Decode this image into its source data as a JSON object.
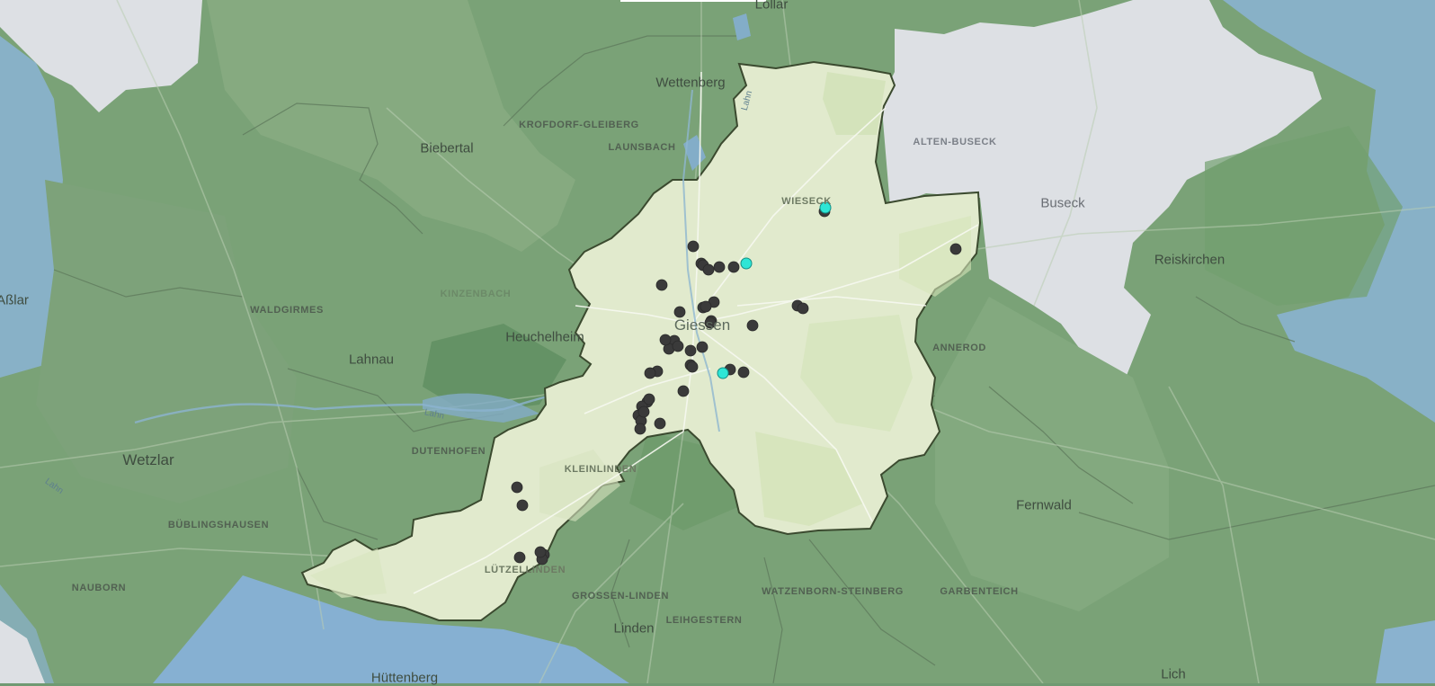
{
  "map": {
    "city_label": "Giessen",
    "town_labels": [
      "Lollar",
      "Wettenberg",
      "Biebertal",
      "Heuchelheim",
      "Lahnau",
      "Wetzlar",
      "Buseck",
      "Reiskirchen",
      "Fernwald",
      "Linden",
      "Hüttenberg",
      "Lich",
      "Aßlar"
    ],
    "district_labels": [
      "KROFDORF-GLEIBERG",
      "LAUNSBACH",
      "WIESECK",
      "ALTEN-BUSECK",
      "KINZENBACH",
      "WALDGIRMES",
      "DUTENHOFEN",
      "KLEINLINDEN",
      "BÜBLINGSHAUSEN",
      "NAUBORN",
      "LÜTZELLINDEN",
      "GROSSEN-LINDEN",
      "LEIHGESTERN",
      "WATZENBORN-STEINBERG",
      "GARBENTEICH",
      "ANNEROD"
    ],
    "water_labels": [
      "Lahn",
      "Lahn",
      "Lahn"
    ],
    "markers": {
      "dark_count": 45,
      "highlight_count": 3,
      "dark_color": "#3a3a3a",
      "highlight_color": "#2ee6d6"
    },
    "colors": {
      "city_area": "#e2ebcf",
      "surrounding_region": "#7ba277",
      "neighbor_gray": "#dcdfe3",
      "water_blue": "#8fb3cf",
      "border": "#3b4a2f"
    }
  }
}
